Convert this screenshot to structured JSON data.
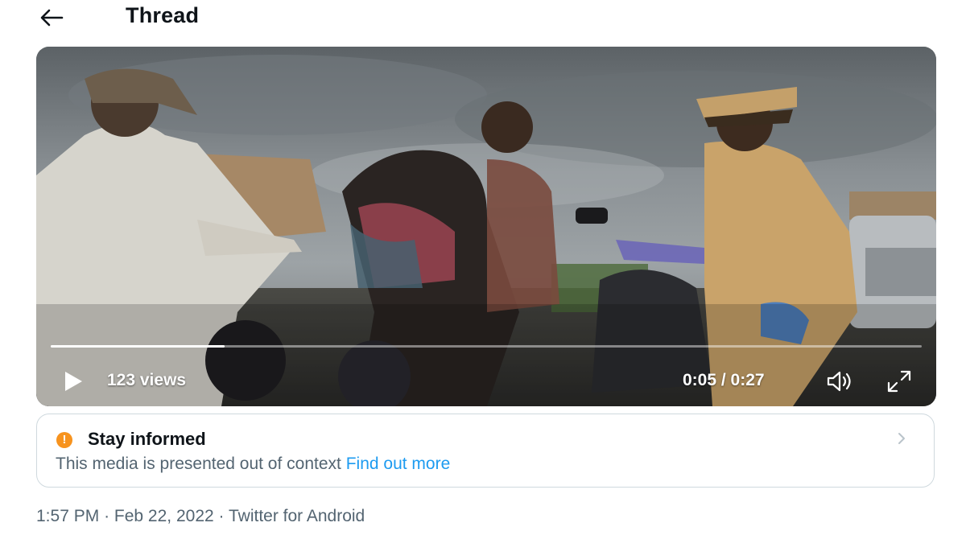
{
  "header": {
    "title": "Thread",
    "back_icon": "arrow-left-icon"
  },
  "video": {
    "views_label": "123 views",
    "time_label": "0:05 / 0:27",
    "progress_fraction": 0.2,
    "icons": {
      "play": "play-icon",
      "volume": "volume-icon",
      "fullscreen": "fullscreen-icon"
    }
  },
  "notice": {
    "title": "Stay informed",
    "body": "This media is presented out of context",
    "link_label": "Find out more",
    "warning_glyph": "!",
    "icon_color": "#f7931e",
    "link_color": "#1d9bf0"
  },
  "meta": {
    "time": "1:57 PM",
    "separator": "·",
    "date": "Feb 22, 2022",
    "source": "Twitter for Android"
  }
}
